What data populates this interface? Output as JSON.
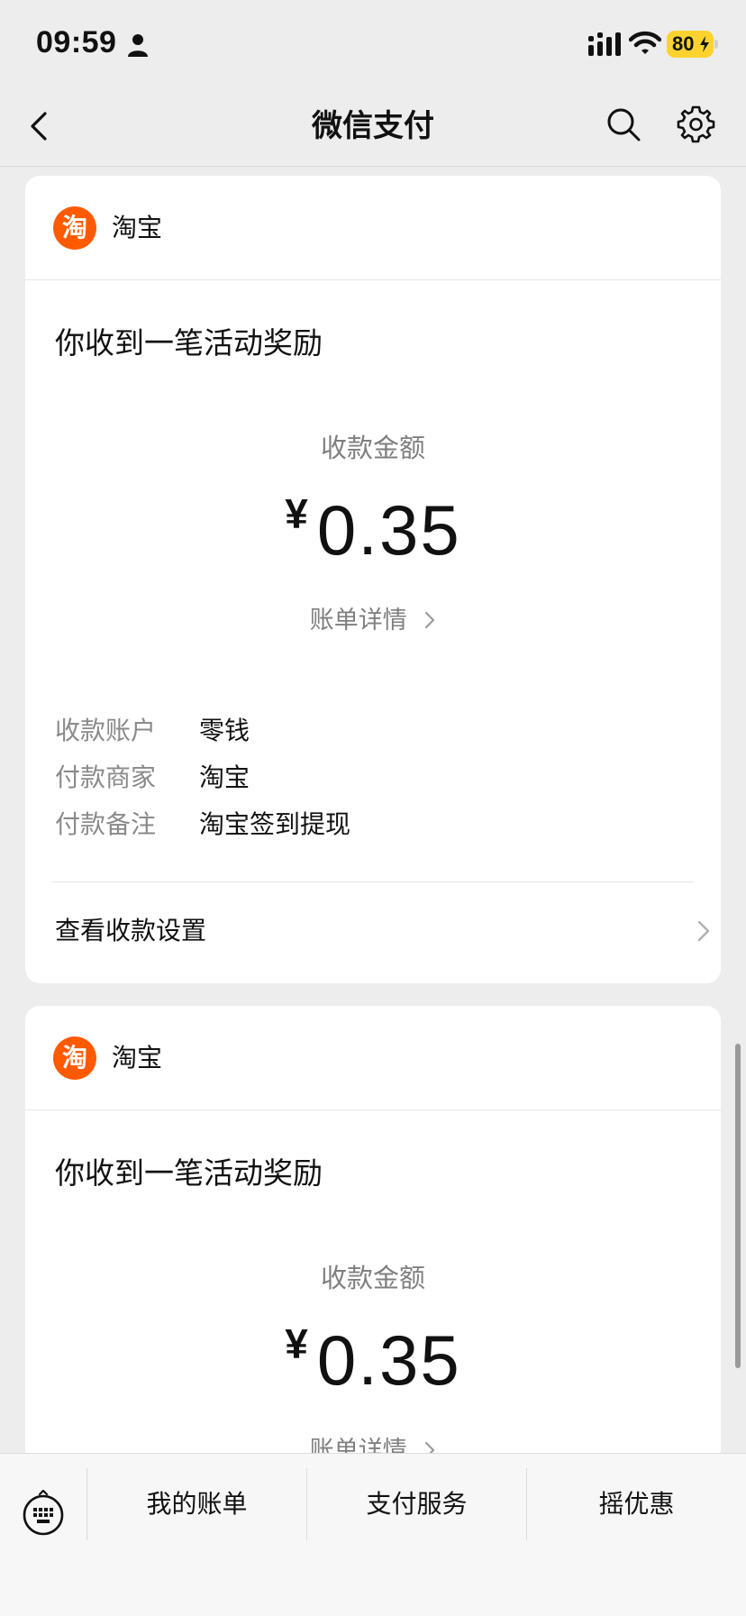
{
  "status_bar": {
    "time": "09:59",
    "battery": "80"
  },
  "nav": {
    "title": "微信支付"
  },
  "messages": [
    {
      "merchant": "淘宝",
      "logo_glyph": "淘",
      "title": "你收到一笔活动奖励",
      "amount_label": "收款金额",
      "currency": "¥",
      "amount": "0.35",
      "bill_detail": "账单详情",
      "info": [
        {
          "label": "收款账户",
          "value": "零钱"
        },
        {
          "label": "付款商家",
          "value": "淘宝"
        },
        {
          "label": "付款备注",
          "value": "淘宝签到提现"
        }
      ],
      "settings_link": "查看收款设置"
    },
    {
      "merchant": "淘宝",
      "logo_glyph": "淘",
      "title": "你收到一笔活动奖励",
      "amount_label": "收款金额",
      "currency": "¥",
      "amount": "0.35",
      "bill_detail": "账单详情"
    }
  ],
  "toolbar": {
    "items": [
      "我的账单",
      "支付服务",
      "摇优惠"
    ]
  },
  "colors": {
    "background": "#ededed",
    "card": "#ffffff",
    "taobao_orange": "#ff5a00",
    "battery_yellow": "#fcd32e",
    "secondary_text": "#7f7f7f"
  },
  "icons": [
    "person-icon",
    "signal-icon",
    "wifi-icon",
    "battery-bolt-icon",
    "back-icon",
    "search-icon",
    "gear-icon",
    "chevron-right-icon",
    "keyboard-icon"
  ]
}
